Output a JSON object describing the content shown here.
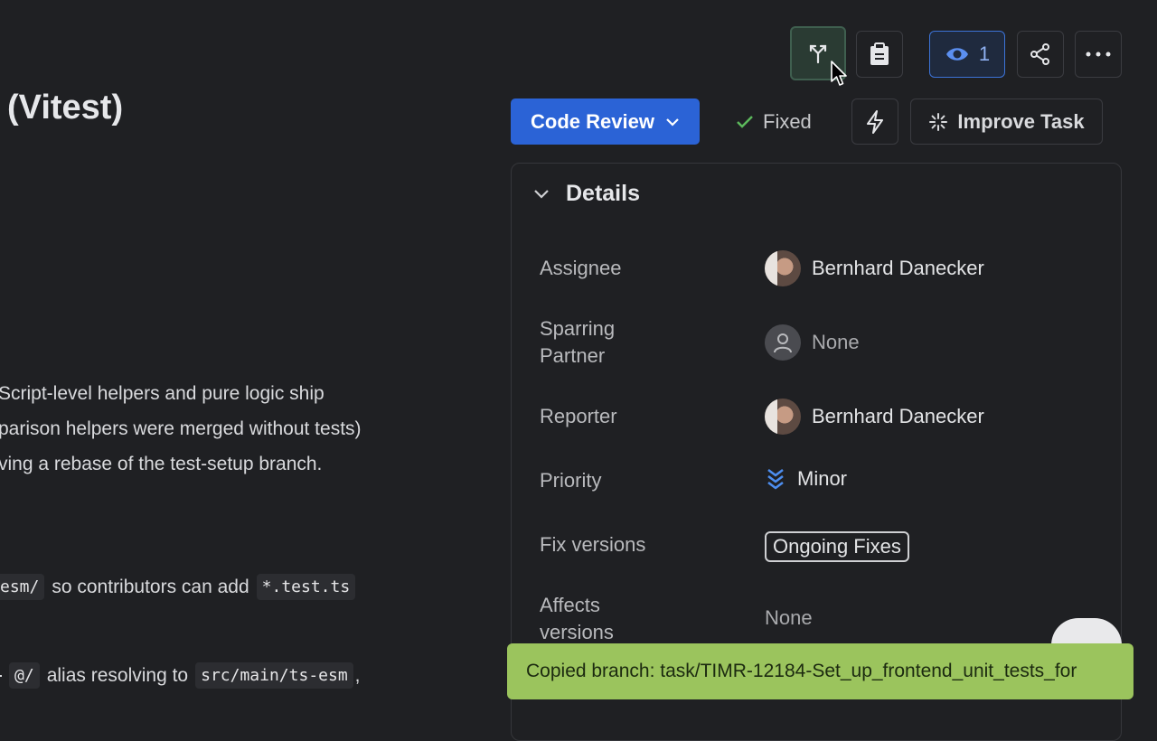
{
  "page": {
    "title": "(Vitest)"
  },
  "description": {
    "lines": [
      "Script-level helpers and pure logic ship",
      "parison helpers were merged without tests)",
      "ving a rebase of the test-setup branch."
    ],
    "line4": {
      "code1": "esm/",
      "text": "so contributors can add",
      "code2": "*.test.ts"
    },
    "line5": {
      "code1": "@/",
      "text": "alias resolving to",
      "code2": "src/main/ts-esm",
      "suffix": ","
    }
  },
  "toolbar": {
    "watch_count": "1"
  },
  "status": {
    "workflow_label": "Code Review",
    "resolution": "Fixed",
    "improve_label": "Improve Task"
  },
  "details": {
    "heading": "Details",
    "assignee_label": "Assignee",
    "assignee": "Bernhard Danecker",
    "sparring_label": "Sparring Partner",
    "sparring": "None",
    "reporter_label": "Reporter",
    "reporter": "Bernhard Danecker",
    "priority_label": "Priority",
    "priority": "Minor",
    "fix_versions_label": "Fix versions",
    "fix_versions": "Ongoing Fixes",
    "affects_label": "Affects versions",
    "affects": "None"
  },
  "toast": {
    "message": "Copied branch: task/TIMR-12184-Set_up_frontend_unit_tests_for"
  },
  "colors": {
    "accent": "#2b63d6",
    "toast": "#9bc45d",
    "background": "#1f2023"
  }
}
